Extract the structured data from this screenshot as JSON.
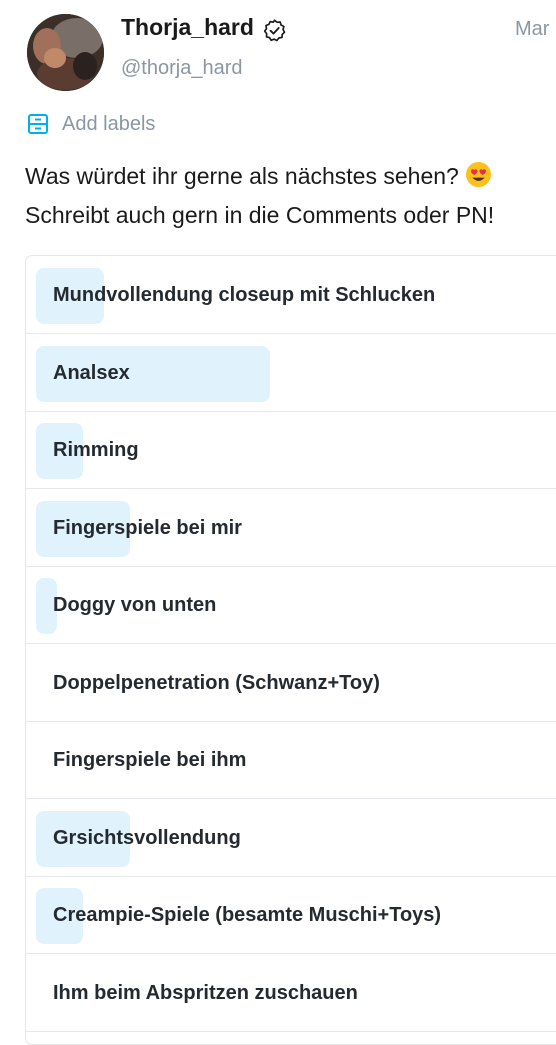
{
  "post": {
    "author": {
      "name": "Thorja_hard",
      "handle": "@thorja_hard",
      "verified": true
    },
    "date": "Mar",
    "add_labels": "Add labels",
    "text_line1": "Was würdet ihr gerne als nächstes sehen?",
    "text_line2": "Schreibt auch gern in die Comments oder PN!",
    "emoji": "heart-eyes-emoji"
  },
  "colors": {
    "accent": "#00aff0",
    "vote_fill": "#e0f3fd",
    "muted_text": "#8a96a3",
    "border": "#e6e8eb"
  },
  "poll": {
    "options": [
      {
        "label": "Mundvollendung closeup mit Schlucken",
        "percent": 13
      },
      {
        "label": "Analsex",
        "percent": 45
      },
      {
        "label": "Rimming",
        "percent": 9
      },
      {
        "label": "Fingerspiele bei mir",
        "percent": 18
      },
      {
        "label": "Doggy von unten",
        "percent": 4
      },
      {
        "label": "Doppelpenetration (Schwanz+Toy)",
        "percent": 0
      },
      {
        "label": "Fingerspiele bei ihm",
        "percent": 0
      },
      {
        "label": "Grsichtsvollendung",
        "percent": 18
      },
      {
        "label": "Creampie-Spiele (besamte Muschi+Toys)",
        "percent": 9
      },
      {
        "label": "Ihm beim Abspritzen zuschauen",
        "percent": 0
      }
    ]
  }
}
